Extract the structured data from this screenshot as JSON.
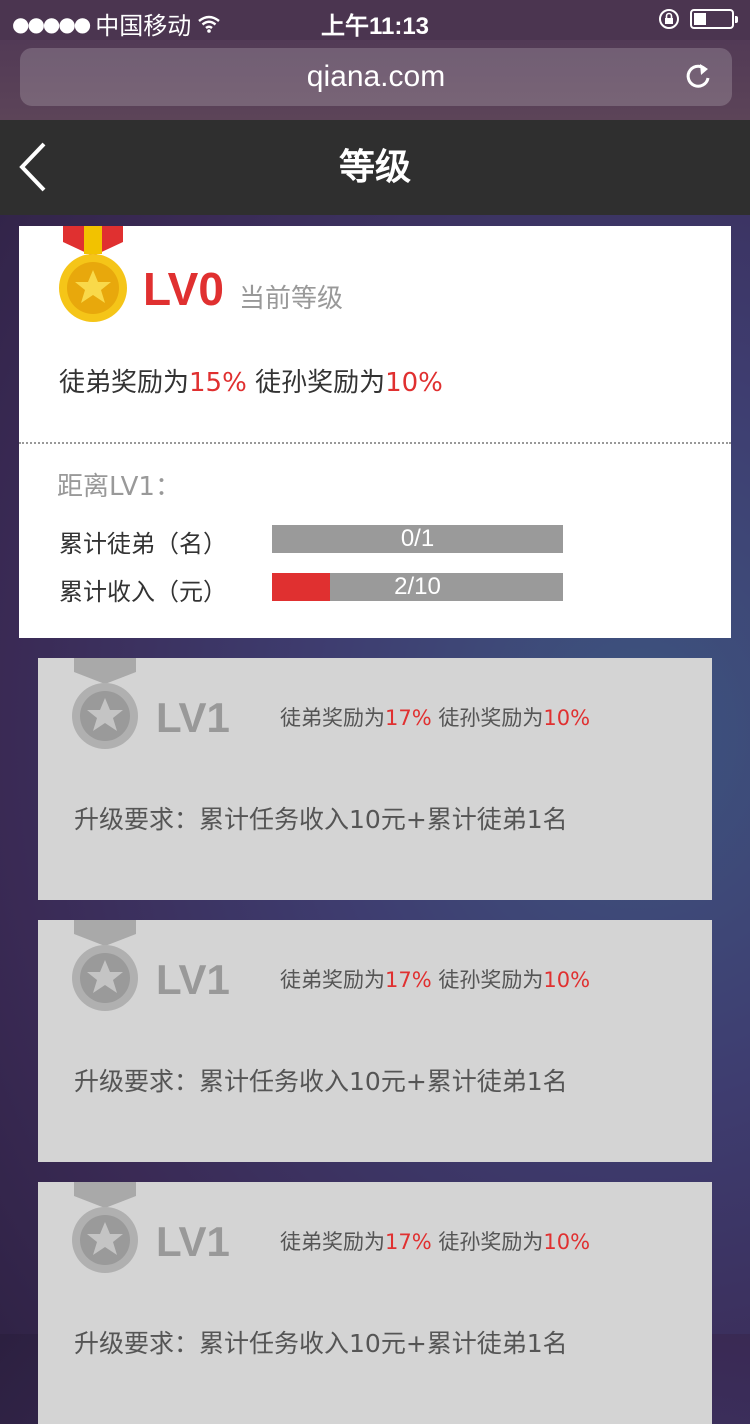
{
  "status_bar": {
    "carrier": "中国移动",
    "time": "上午11:13"
  },
  "browser": {
    "url": "qiana.com"
  },
  "nav": {
    "title": "等级"
  },
  "current": {
    "level": "LV0",
    "level_caption": "当前等级",
    "reward_disciple_label": "徒弟奖励为",
    "reward_disciple_value": "15%",
    "reward_grand_label": "徒孙奖励为",
    "reward_grand_value": "10%",
    "distance_label": "距离LV1：",
    "progress": [
      {
        "label": "累计徒弟（名）",
        "text": "0/1",
        "value": 0,
        "max": 1
      },
      {
        "label": "累计收入（元）",
        "text": "2/10",
        "value": 2,
        "max": 10
      }
    ]
  },
  "levels": [
    {
      "name": "LV1",
      "reward_disciple_label": "徒弟奖励为",
      "reward_disciple_value": "17%",
      "reward_grand_label": "徒孙奖励为",
      "reward_grand_value": "10%",
      "requirement": "升级要求：累计任务收入10元+累计徒弟1名"
    },
    {
      "name": "LV1",
      "reward_disciple_label": "徒弟奖励为",
      "reward_disciple_value": "17%",
      "reward_grand_label": "徒孙奖励为",
      "reward_grand_value": "10%",
      "requirement": "升级要求：累计任务收入10元+累计徒弟1名"
    },
    {
      "name": "LV1",
      "reward_disciple_label": "徒弟奖励为",
      "reward_disciple_value": "17%",
      "reward_grand_label": "徒孙奖励为",
      "reward_grand_value": "10%",
      "requirement": "升级要求：累计任务收入10元+累计徒弟1名"
    }
  ],
  "colors": {
    "accent": "#e03030",
    "bar_bg": "#9a9a9a",
    "card_locked": "#d4d4d4"
  }
}
